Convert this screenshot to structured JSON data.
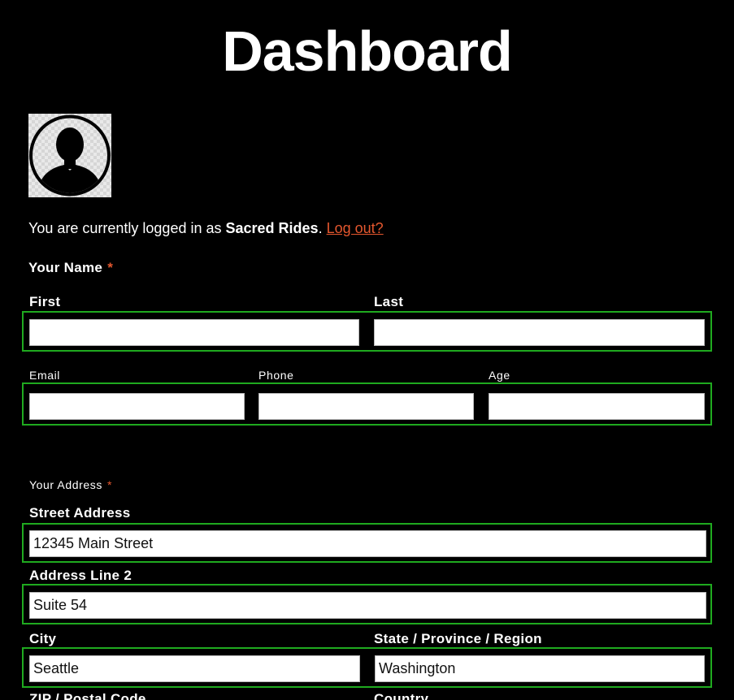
{
  "page": {
    "title": "Dashboard"
  },
  "account": {
    "prefix": "You are currently logged in as ",
    "username": "Sacred Rides",
    "separator": ". ",
    "logout_label": "Log out?"
  },
  "name_section": {
    "label": "Your Name",
    "required_mark": "*",
    "first_label": "First",
    "first_value": "",
    "last_label": "Last",
    "last_value": ""
  },
  "contact": {
    "email_label": "Email",
    "email_value": "",
    "phone_label": "Phone",
    "phone_value": "",
    "age_label": "Age",
    "age_value": ""
  },
  "address_section": {
    "label": "Your Address",
    "required_mark": "*",
    "street_label": "Street Address",
    "street_value": "12345 Main Street",
    "line2_label": "Address Line 2",
    "line2_value": "Suite 54",
    "city_label": "City",
    "city_value": "Seattle",
    "state_label": "State / Province / Region",
    "state_value": "Washington",
    "zip_label": "ZIP / Postal Code",
    "country_label": "Country"
  },
  "colors": {
    "background": "#000000",
    "accent": "#e4572e",
    "group_outline": "#1faa1f"
  },
  "icons": {
    "avatar": "user-silhouette-icon"
  }
}
